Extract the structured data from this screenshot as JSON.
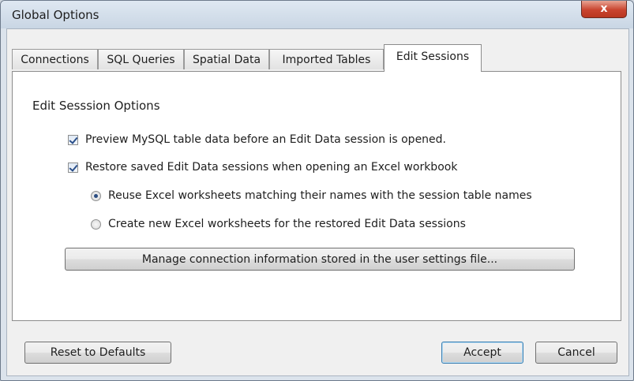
{
  "window": {
    "title": "Global Options",
    "close_glyph": "x"
  },
  "tabs": [
    {
      "label": "Connections",
      "active": false
    },
    {
      "label": "SQL Queries",
      "active": false
    },
    {
      "label": "Spatial Data",
      "active": false
    },
    {
      "label": "Imported Tables",
      "active": false
    },
    {
      "label": "Edit Sessions",
      "active": true
    }
  ],
  "panel": {
    "section_title": "Edit Sesssion Options",
    "options": {
      "preview_label": "Preview MySQL table data before an Edit Data session is opened.",
      "preview_checked": true,
      "restore_label": "Restore saved Edit Data sessions when opening an Excel workbook",
      "restore_checked": true,
      "reuse_label": "Reuse Excel worksheets matching their names with the session table names",
      "reuse_selected": true,
      "create_label": "Create new Excel worksheets for the restored Edit Data sessions",
      "create_selected": false
    },
    "manage_button_label": "Manage connection information stored in the user settings file..."
  },
  "footer": {
    "reset_label": "Reset to Defaults",
    "accept_label": "Accept",
    "cancel_label": "Cancel"
  },
  "colors": {
    "close_button": "#c9442f",
    "default_button_border": "#3c7fb1"
  }
}
